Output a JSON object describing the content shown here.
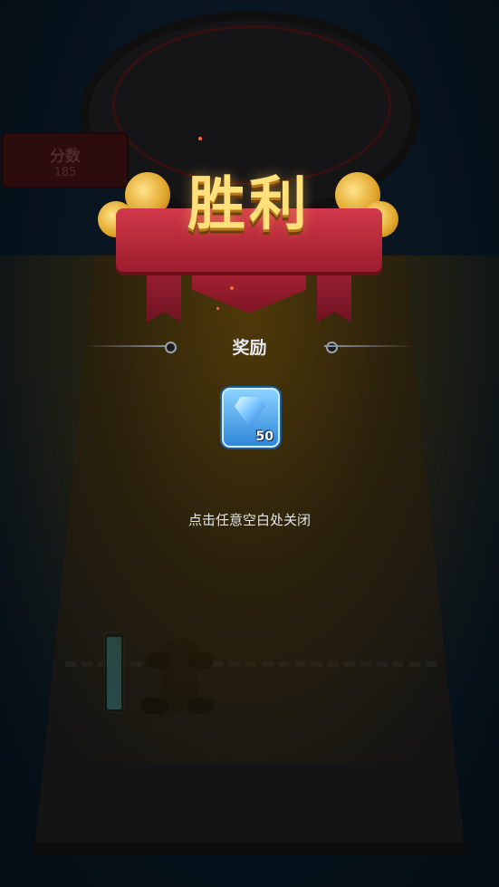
{
  "hud": {
    "score_label": "分数",
    "score_value": "185"
  },
  "result": {
    "title": "胜利"
  },
  "reward": {
    "title": "奖励",
    "items": [
      {
        "icon": "diamond-icon",
        "quantity": "50"
      }
    ]
  },
  "hint": "点击任意空白处关闭",
  "colors": {
    "title": "#ffe07a",
    "ribbon": "#c62f41",
    "reward_tile": "#4aa6f0",
    "overlay_glow": "#78560a"
  }
}
